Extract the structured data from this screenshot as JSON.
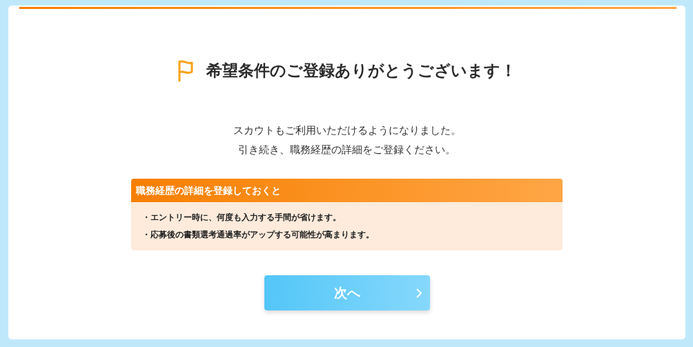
{
  "title": "希望条件のご登録ありがとうございます！",
  "message": [
    "スカウトもご利用いただけるようになりました。",
    "引き続き、職務経歴の詳細をご登録ください。"
  ],
  "info_box": {
    "heading": "職務経歴の詳細を登録しておくと",
    "items": [
      "・エントリー時に、何度も入力する手間が省けます。",
      "・応募後の書類選考通過率がアップする可能性が高まります。"
    ]
  },
  "next_button": {
    "label": "次へ"
  }
}
